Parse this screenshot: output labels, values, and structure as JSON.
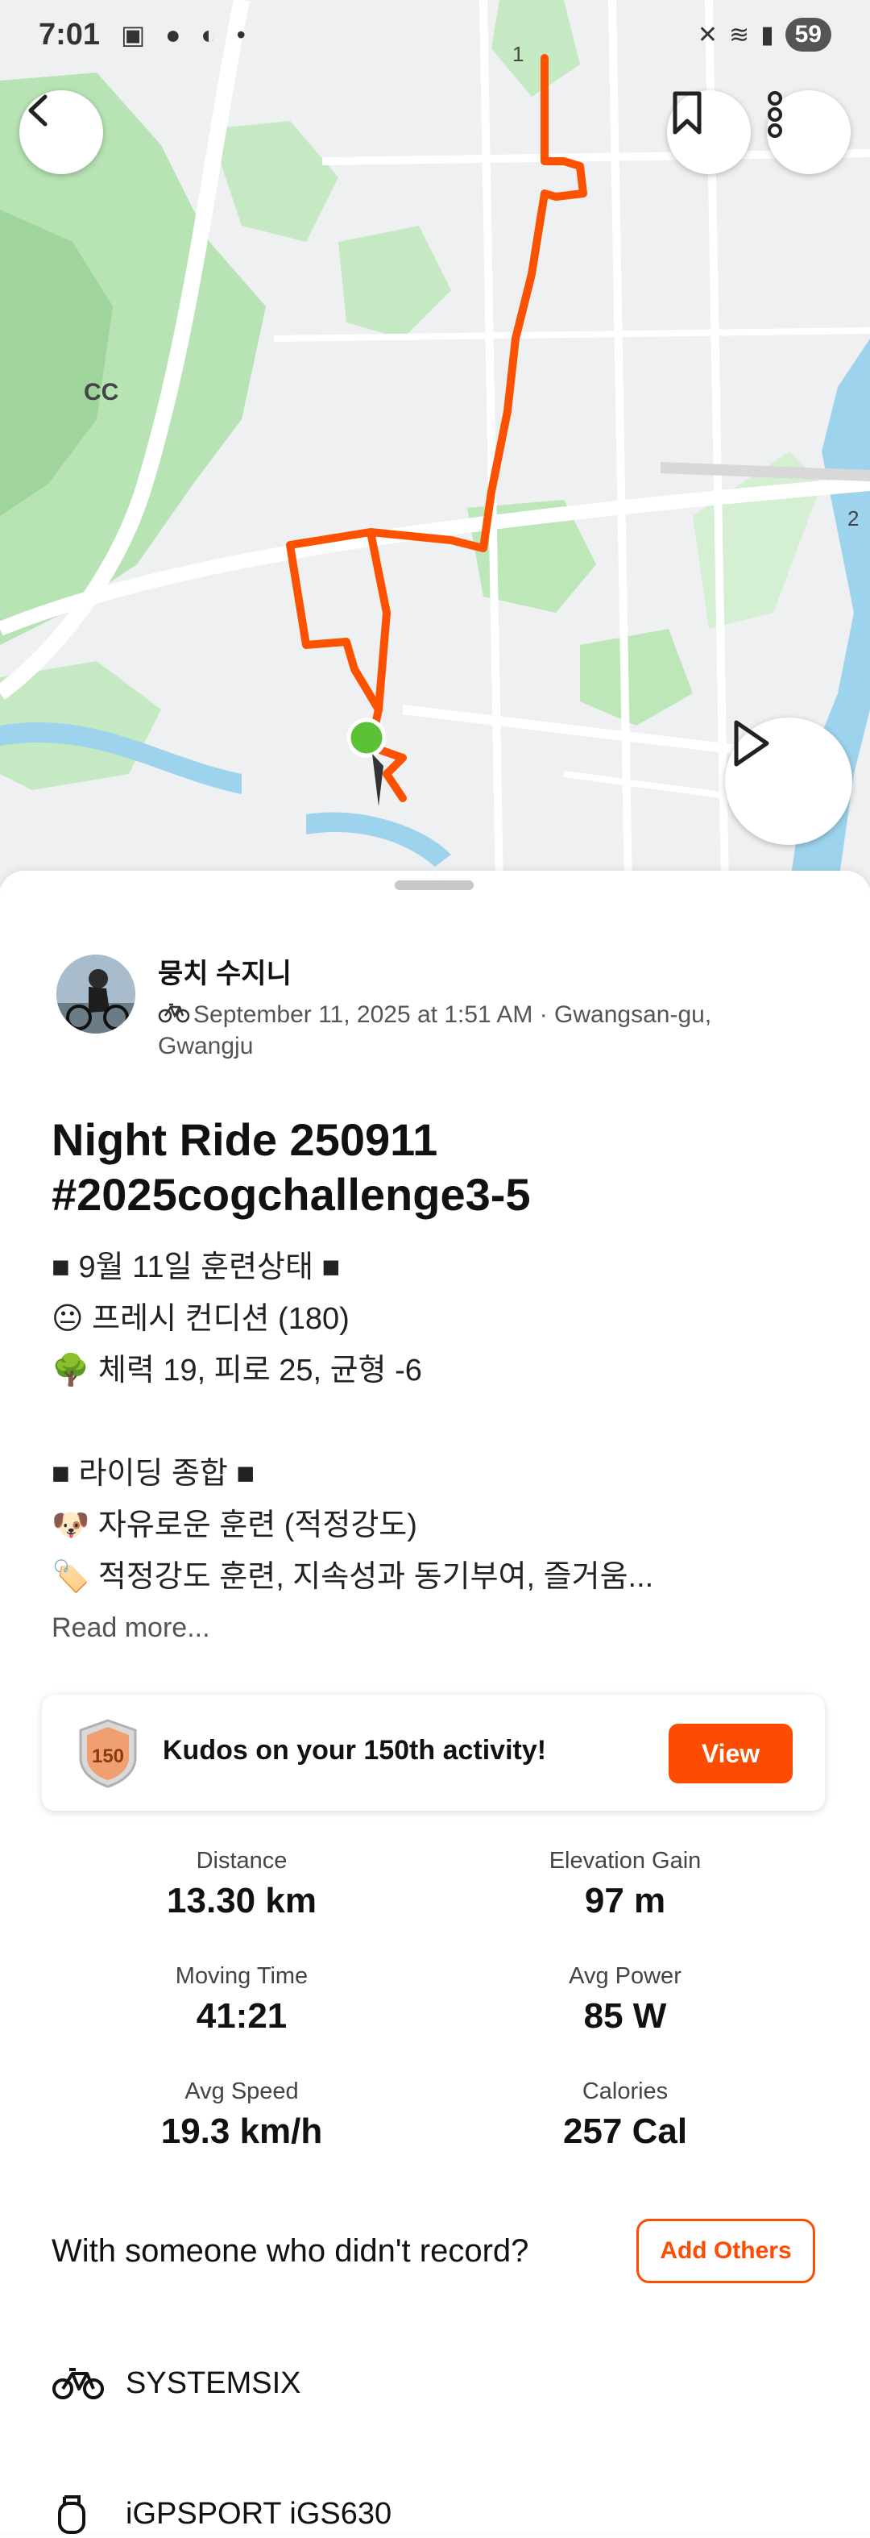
{
  "status_bar": {
    "time": "7:01",
    "battery": "59"
  },
  "map": {
    "label_cc": "CC",
    "route_number": "1",
    "road_number_right": "2"
  },
  "activity": {
    "athlete_name": "뭉치 수지니",
    "meta": "September 11, 2025 at 1:51 AM · Gwangsan-gu, Gwangju",
    "title_line1": "Night Ride 250911",
    "title_line2": "#2025cogchallenge3-5",
    "description": [
      "■ 9월 11일 훈련상태 ■",
      "😐 프레시 컨디션 (180)",
      "🌳 체력 19, 피로 25, 균형 -6",
      "",
      "■ 라이딩 종합 ■",
      "🐶 자유로운 훈련 (적정강도)",
      "🏷️ 적정강도 훈련, 지속성과 동기부여, 즐거움..."
    ],
    "read_more": "Read more..."
  },
  "kudos": {
    "text": "Kudos on your 150th activity!",
    "badge_number": "150",
    "button": "View"
  },
  "stats": [
    {
      "label": "Distance",
      "value": "13.30 km"
    },
    {
      "label": "Elevation Gain",
      "value": "97 m"
    },
    {
      "label": "Moving Time",
      "value": "41:21"
    },
    {
      "label": "Avg Power",
      "value": "85 W"
    },
    {
      "label": "Avg Speed",
      "value": "19.3 km/h"
    },
    {
      "label": "Calories",
      "value": "257 Cal"
    }
  ],
  "others": {
    "prompt": "With someone who didn't record?",
    "button": "Add Others"
  },
  "gear": {
    "bike": "SYSTEMSIX",
    "device": "iGPSPORT iGS630"
  },
  "colors": {
    "accent": "#fc4c02",
    "route": "#fc5200",
    "start_marker": "#5bc236"
  }
}
